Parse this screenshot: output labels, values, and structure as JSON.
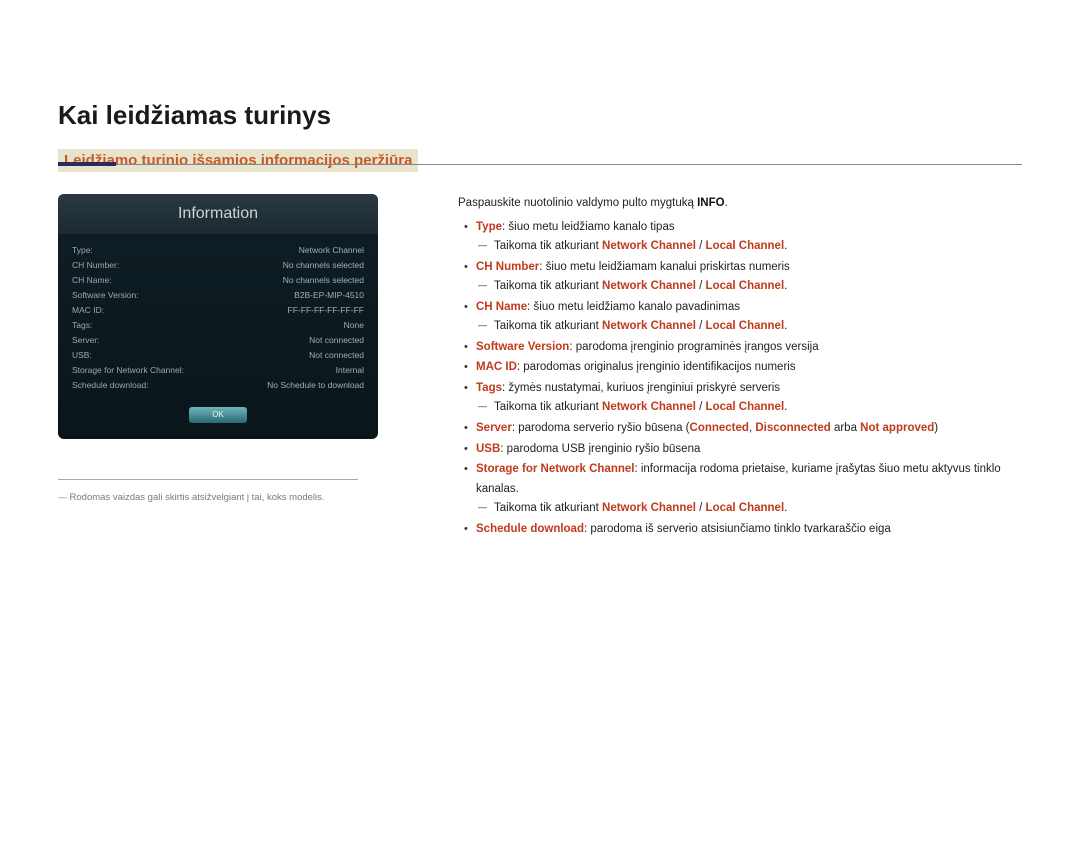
{
  "h1": "Kai leidžiamas turinys",
  "h2": "Leidžiamo turinio išsamios informacijos peržiūra",
  "intro_prefix": "Paspauskite nuotolinio valdymo pulto mygtuką ",
  "intro_bold": "INFO",
  "intro_suffix": ".",
  "applies_prefix": "Taikoma tik atkuriant ",
  "applies_nc": "Network Channel",
  "applies_sep": " / ",
  "applies_lc": "Local Channel",
  "applies_end": ".",
  "items": {
    "type": {
      "label": "Type",
      "desc": ": šiuo metu leidžiamo kanalo tipas",
      "note": true
    },
    "chnum": {
      "label": "CH Number",
      "desc": ": šiuo metu leidžiamam kanalui priskirtas numeris",
      "note": true
    },
    "chname": {
      "label": "CH Name",
      "desc": ": šiuo metu leidžiamo kanalo pavadinimas",
      "note": true
    },
    "swver": {
      "label": "Software Version",
      "desc": ": parodoma įrenginio programinės įrangos versija",
      "note": false
    },
    "macid": {
      "label": "MAC ID",
      "desc": ": parodomas originalus įrenginio identifikacijos numeris",
      "note": false
    },
    "tags": {
      "label": "Tags",
      "desc": ": žymės nustatymai, kuriuos įrenginiui priskyrė serveris",
      "note": true
    },
    "server": {
      "label": "Server",
      "pre": ": parodoma serverio ryšio būsena (",
      "c1": "Connected",
      "s1": ", ",
      "c2": "Disconnected",
      "s2": " arba ",
      "c3": "Not approved",
      "suf": ")"
    },
    "usb": {
      "label": "USB",
      "desc": ": parodoma USB įrenginio ryšio būsena",
      "note": false
    },
    "storage": {
      "label": "Storage for Network Channel",
      "desc": ": informacija rodoma prietaise, kuriame įrašytas šiuo metu aktyvus tinklo kanalas.",
      "note": true
    },
    "sched": {
      "label": "Schedule download",
      "desc": ": parodoma iš serverio atsisiunčiamo tinklo tvarkaraščio eiga",
      "note": false
    }
  },
  "footnote": "Rodomas vaizdas gali skirtis atsižvelgiant į tai, koks modelis.",
  "shot": {
    "title": "Information",
    "rows": [
      {
        "k": "Type:",
        "v": "Network Channel"
      },
      {
        "k": "CH Number:",
        "v": "No channels selected"
      },
      {
        "k": "CH Name:",
        "v": "No channels selected"
      },
      {
        "k": "Software Version:",
        "v": "B2B-EP-MIP-4510"
      },
      {
        "k": "MAC ID:",
        "v": "FF-FF-FF-FF-FF-FF"
      },
      {
        "k": "Tags:",
        "v": "None"
      },
      {
        "k": "Server:",
        "v": "Not connected"
      },
      {
        "k": "USB:",
        "v": "Not connected"
      },
      {
        "k": "Storage for Network Channel:",
        "v": "Internal"
      },
      {
        "k": "Schedule download:",
        "v": "No Schedule to download"
      }
    ],
    "ok": "OK"
  }
}
